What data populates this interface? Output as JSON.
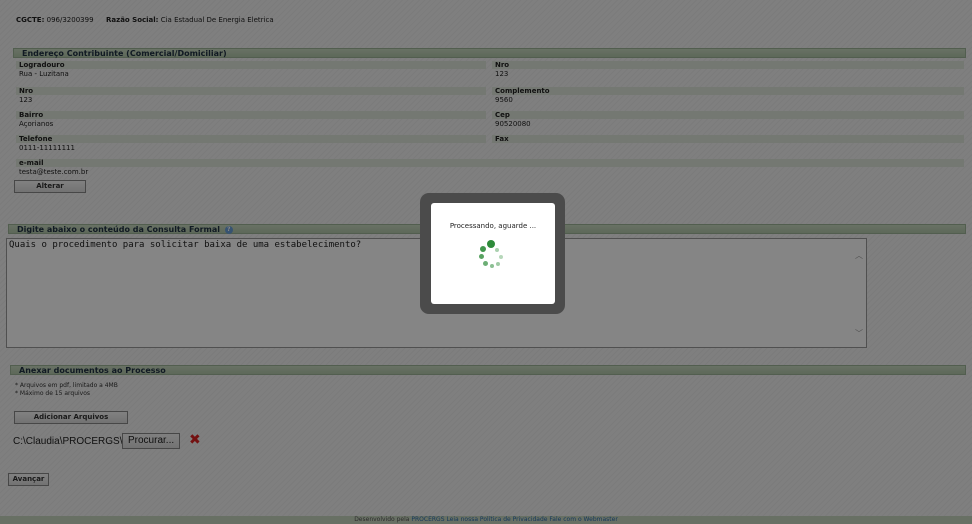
{
  "header": {
    "cgcte_label": "CGCTE:",
    "cgcte_value": "096/3200399",
    "razao_label": "Razão Social:",
    "razao_value": "Cia Estadual De Energia Eletrica"
  },
  "endereco": {
    "title": "Endereço Contribuinte (Comercial/Domiciliar)",
    "logradouro_label": "Logradouro",
    "logradouro_value": "Rua - Luzitana",
    "nro_label": "Nro",
    "nro_value": "123",
    "nro2_label": "Nro",
    "nro2_value": "123",
    "complemento_label": "Complemento",
    "complemento_value": "9560",
    "bairro_label": "Bairro",
    "bairro_value": "Açorianos",
    "cep_label": "Cep",
    "cep_value": "90520080",
    "telefone_label": "Telefone",
    "telefone_value": "0111-11111111",
    "fax_label": "Fax",
    "fax_value": "",
    "email_label": "e-mail",
    "email_value": "testa@teste.com.br",
    "alterar_label": "Alterar"
  },
  "consulta": {
    "title": "Digite abaixo o conteúdo da Consulta Formal",
    "text": "Quais o procedimento para solicitar baixa de uma estabelecimento?",
    "help_icon": "question-icon"
  },
  "anexar": {
    "title": "Anexar documentos ao Processo",
    "note1": "* Arquivos em pdf, limitado a 4MB",
    "note2": "* Máximo de 15 arquivos",
    "add_label": "Adicionar Arquivos",
    "file_path": "C:\\Claudia\\PROCERGS\\E",
    "browse_label": "Procurar...",
    "remove_icon": "close-x-icon"
  },
  "avancar_label": "Avançar",
  "footer": {
    "prefix": "Desenvolvido pela",
    "procergs": "PROCERGS",
    "privacy": "Leia nossa Política de Privacidade",
    "contact": "Fale com o Webmaster"
  },
  "modal": {
    "message": "Processando, aguarde ..."
  },
  "colors": {
    "section_bar": "#b3c9aa",
    "spinner": "#2e8b3a",
    "remove": "#d22222"
  }
}
